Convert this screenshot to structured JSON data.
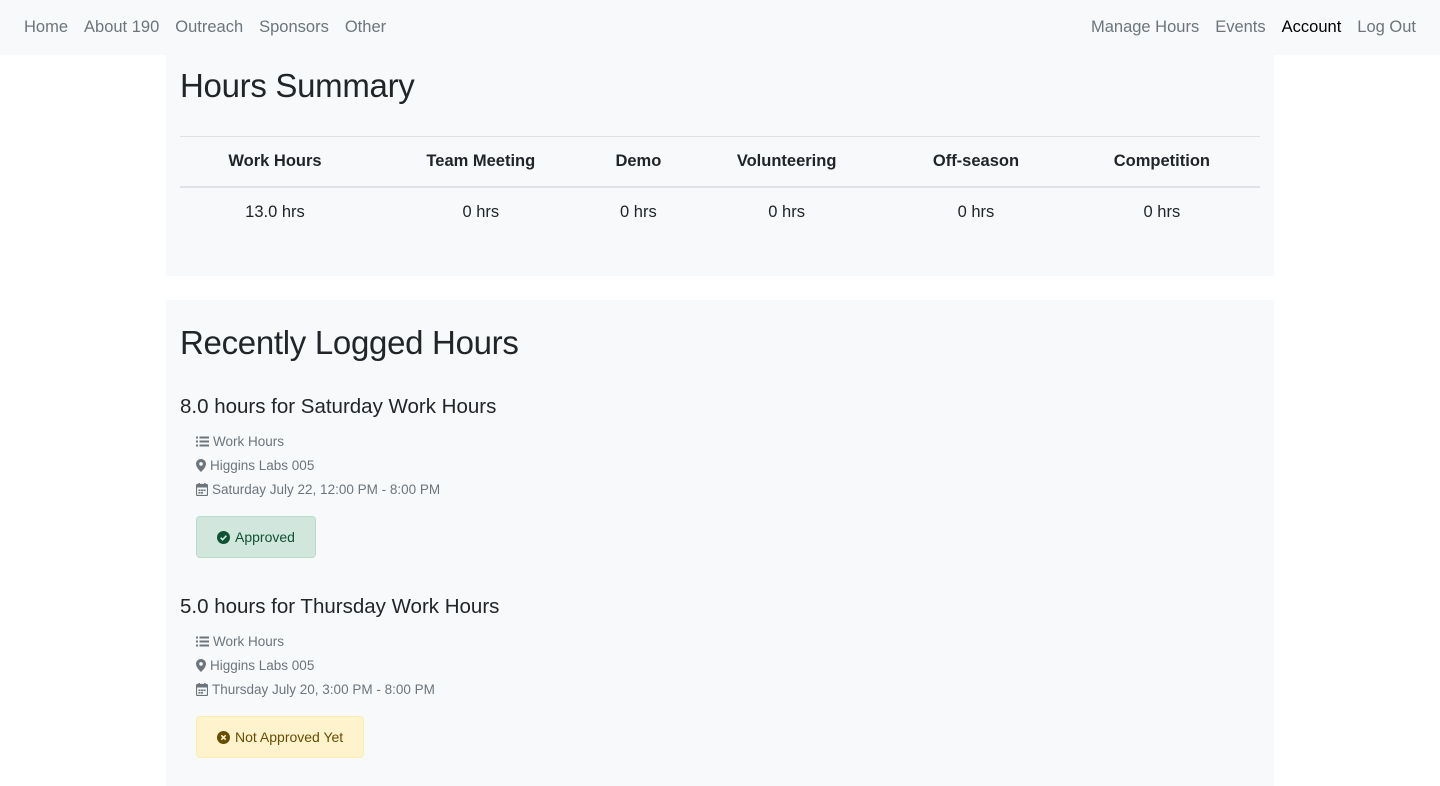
{
  "nav": {
    "left": [
      "Home",
      "About 190",
      "Outreach",
      "Sponsors",
      "Other"
    ],
    "right": [
      "Manage Hours",
      "Events",
      "Account",
      "Log Out"
    ],
    "active": "Account"
  },
  "summary": {
    "title": "Hours Summary",
    "headers": [
      "Work Hours",
      "Team Meeting",
      "Demo",
      "Volunteering",
      "Off-season",
      "Competition"
    ],
    "values": [
      "13.0 hrs",
      "0 hrs",
      "0 hrs",
      "0 hrs",
      "0 hrs",
      "0 hrs"
    ]
  },
  "recent": {
    "title": "Recently Logged Hours",
    "entries": [
      {
        "title": "8.0 hours for Saturday Work Hours",
        "category": "Work Hours",
        "location": "Higgins Labs 005",
        "datetime": "Saturday July 22, 12:00 PM - 8:00 PM",
        "status": "Approved"
      },
      {
        "title": "5.0 hours for Thursday Work Hours",
        "category": "Work Hours",
        "location": "Higgins Labs 005",
        "datetime": "Thursday July 20, 3:00 PM - 8:00 PM",
        "status": "Not Approved Yet"
      }
    ]
  },
  "colors": {
    "navbar_bg": "#f8f9fa",
    "approved_bg": "#d1e7dd",
    "approved_text": "#0f5132",
    "pending_bg": "#fff3cd",
    "pending_text": "#664d03"
  },
  "icons": {
    "category": "list-icon",
    "location": "map-pin-icon",
    "datetime": "calendar-icon",
    "approved": "check-circle-icon",
    "pending": "x-circle-icon"
  }
}
